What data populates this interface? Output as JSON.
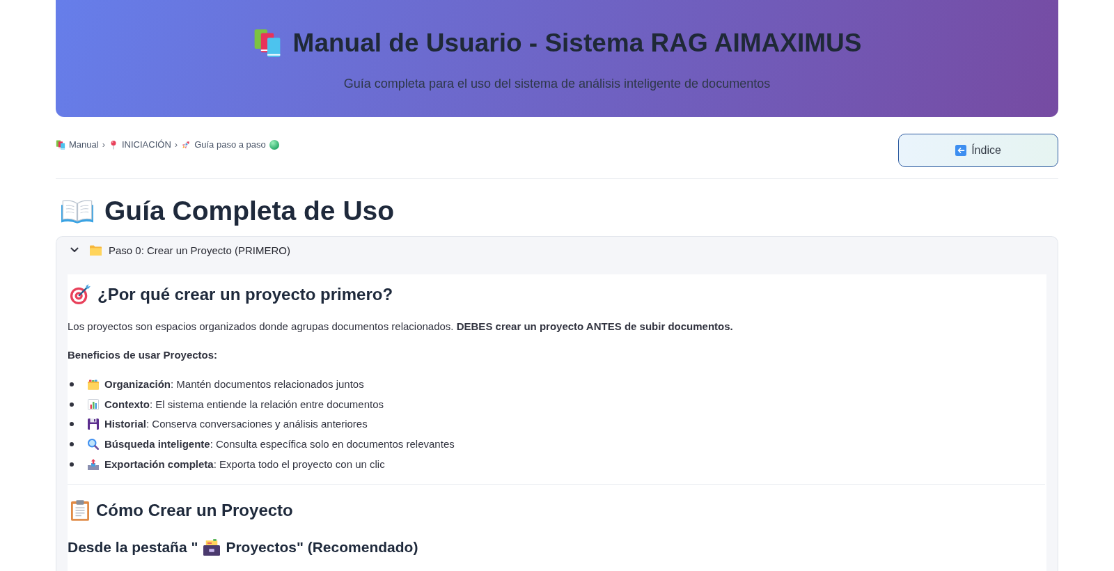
{
  "header": {
    "title": "Manual de Usuario - Sistema RAG AIMAXIMUS",
    "subtitle": "Guía completa para el uso del sistema de análisis inteligente de documentos"
  },
  "breadcrumb": [
    {
      "label": "Manual",
      "separator": "›"
    },
    {
      "label": "INICIACIÓN",
      "separator": "›"
    },
    {
      "label": "Guía paso a paso"
    }
  ],
  "index_button": {
    "label": "Índice"
  },
  "page_title": "Guía Completa de Uso",
  "sections": [
    {
      "title": "Paso 0: Crear un Proyecto (PRIMERO)",
      "expanded": true,
      "content": {
        "heading": "¿Por qué crear un proyecto primero?",
        "intro": "Los proyectos son espacios organizados donde agrupas documentos relacionados. **DEBES crear un proyecto ANTES de subir documentos.**",
        "benefits_title": "Beneficios de usar Proyectos:",
        "benefits": [
          "**Organización**: Mantén documentos relacionados juntos",
          "**Contexto**: El sistema entiende la relación entre documentos",
          "**Historial**: Conserva conversaciones y análisis anteriores",
          "**Búsqueda inteligente**: Consulta específica solo en documentos relevantes",
          "**Exportación completa**: Exporta todo el proyecto con un clic"
        ],
        "heading_2": "Cómo Crear un Proyecto",
        "subheading": {
          "before": "Desde la pestaña \"",
          "after": "Proyectos\" (Recomendado)"
        }
      }
    }
  ]
}
